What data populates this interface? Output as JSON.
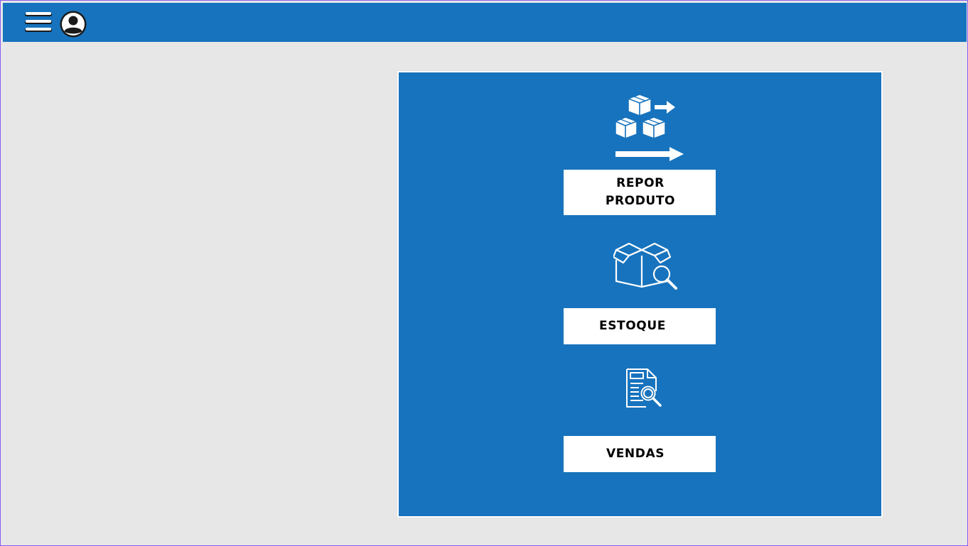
{
  "topbar": {
    "menu_icon": "hamburger-menu-icon",
    "user_icon": "user-avatar-icon",
    "color": "#1773bd"
  },
  "panel": {
    "color": "#1773bd",
    "items": [
      {
        "label": "REPOR PRODUTO",
        "icon": "boxes-delivery-icon"
      },
      {
        "label": "ESTOQUE",
        "icon": "box-search-icon"
      },
      {
        "label": "VENDAS",
        "icon": "report-search-icon"
      }
    ]
  }
}
